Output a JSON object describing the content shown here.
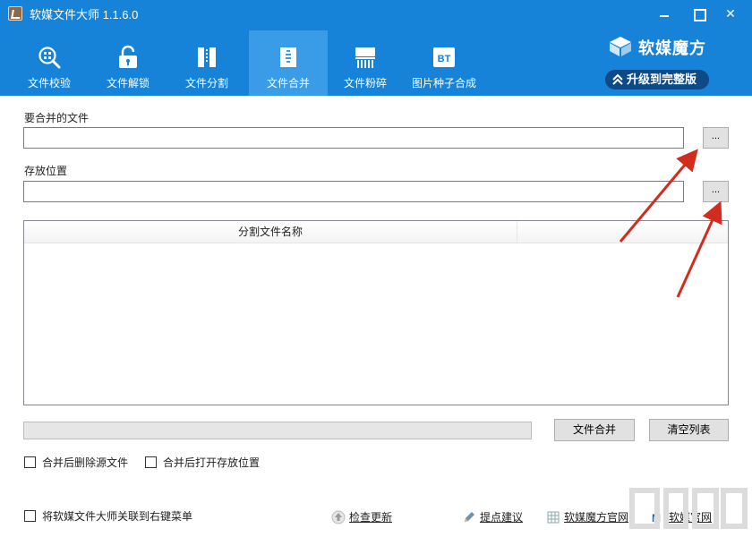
{
  "window": {
    "title": "软媒文件大师 1.1.6.0",
    "controls": [
      "minimize",
      "maximize",
      "close"
    ]
  },
  "tabs": [
    {
      "label": "文件校验",
      "icon": "file-verify-icon",
      "active": false
    },
    {
      "label": "文件解锁",
      "icon": "unlock-icon",
      "active": false
    },
    {
      "label": "文件分割",
      "icon": "file-split-icon",
      "active": false
    },
    {
      "label": "文件合并",
      "icon": "file-merge-icon",
      "active": true
    },
    {
      "label": "文件粉碎",
      "icon": "shredder-icon",
      "active": false
    },
    {
      "label": "图片种子合成",
      "icon": "bt-icon",
      "active": false
    }
  ],
  "brand": {
    "name": "软媒魔方",
    "upgrade_label": "升级到完整版"
  },
  "form": {
    "merge_files_label": "要合并的文件",
    "merge_files_value": "",
    "save_location_label": "存放位置",
    "save_location_value": "",
    "browse_label": "..."
  },
  "list": {
    "columns": [
      "分割文件名称",
      ""
    ],
    "rows": []
  },
  "progress": {
    "value": 0
  },
  "actions": {
    "merge_button": "文件合并",
    "clear_button": "清空列表"
  },
  "options": {
    "delete_source": "合并后删除源文件",
    "open_location": "合并后打开存放位置",
    "context_menu": "将软媒文件大师关联到右键菜单"
  },
  "footer_links": [
    {
      "label": "检查更新",
      "icon": "update-icon"
    },
    {
      "label": "提点建议",
      "icon": "feedback-icon"
    },
    {
      "label": "软媒魔方官网",
      "icon": "mofang-site-icon"
    },
    {
      "label": "软媒官网",
      "icon": "ruanmei-site-icon"
    }
  ],
  "colors": {
    "header_blue": "#1683d8",
    "active_tab": "#3a9be6",
    "upgrade_bg": "#0d4a86",
    "annotation_arrow": "#d42b1f"
  }
}
